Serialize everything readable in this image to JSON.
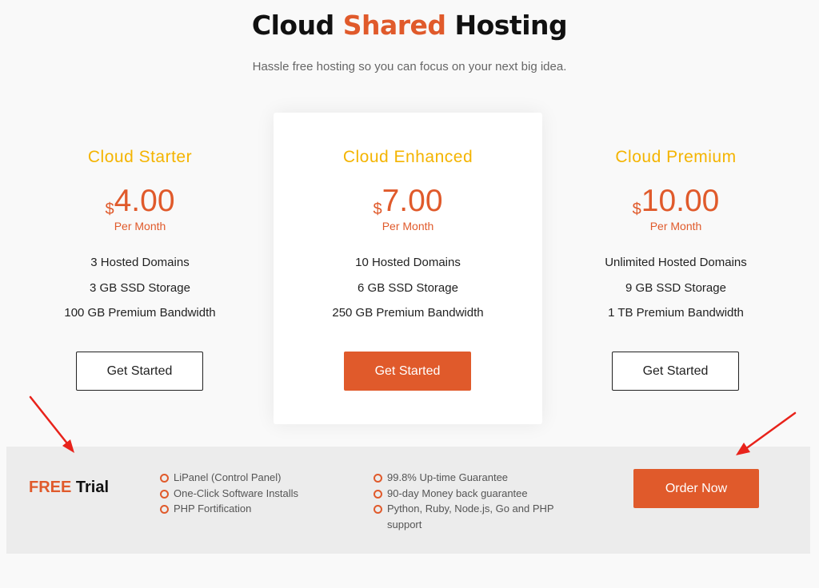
{
  "header": {
    "title_part1": "Cloud ",
    "title_accent": "Shared",
    "title_part2": " Hosting",
    "subtitle": "Hassle free hosting so you can focus on your next big idea."
  },
  "plans": [
    {
      "name": "Cloud Starter",
      "currency": "$",
      "price": "4.00",
      "period": "Per Month",
      "features": [
        "3 Hosted Domains",
        "3 GB SSD Storage",
        "100 GB Premium Bandwidth"
      ],
      "button_label": "Get Started"
    },
    {
      "name": "Cloud Enhanced",
      "currency": "$",
      "price": "7.00",
      "period": "Per Month",
      "features": [
        "10 Hosted Domains",
        "6 GB SSD Storage",
        "250 GB Premium Bandwidth"
      ],
      "button_label": "Get Started"
    },
    {
      "name": "Cloud Premium",
      "currency": "$",
      "price": "10.00",
      "period": "Per Month",
      "features": [
        "Unlimited Hosted Domains",
        "9 GB SSD Storage",
        "1 TB Premium Bandwidth"
      ],
      "button_label": "Get Started"
    }
  ],
  "trial": {
    "label_free": "FREE",
    "label_rest": " Trial",
    "features_col1": [
      "LiPanel (Control Panel)",
      "One-Click Software Installs",
      "PHP Fortification"
    ],
    "features_col2": [
      "99.8% Up-time Guarantee",
      "90-day Money back guarantee",
      "Python, Ruby, Node.js, Go and PHP support"
    ],
    "order_label": "Order Now"
  },
  "colors": {
    "accent": "#e05a2b",
    "plan_name": "#f4b400",
    "annotation_arrow": "#e8231b"
  }
}
